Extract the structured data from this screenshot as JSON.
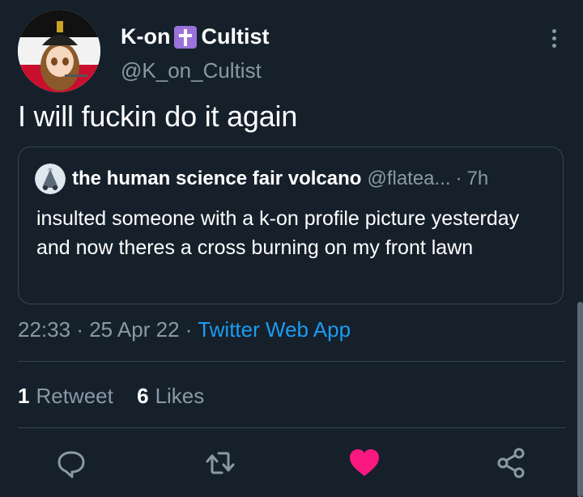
{
  "user": {
    "display_name_part1": "K-on",
    "display_name_part2": "Cultist",
    "handle": "@K_on_Cultist"
  },
  "tweet": {
    "text": "I will fuckin do it again"
  },
  "quote": {
    "name": "the human science fair volcano",
    "handle": "@flatea...",
    "dot": "·",
    "time": "7h",
    "text": "insulted someone with a k-on profile picture yesterday and now theres a cross burning on my front lawn"
  },
  "meta": {
    "time": "22:33",
    "sep1": "·",
    "date": "25 Apr 22",
    "sep2": "·",
    "source": "Twitter Web App"
  },
  "stats": {
    "retweets_count": "1",
    "retweets_label": "Retweet",
    "likes_count": "6",
    "likes_label": "Likes"
  },
  "actions": [
    "reply-icon",
    "retweet-icon",
    "like-icon",
    "share-icon"
  ],
  "colors": {
    "background": "#15202b",
    "link": "#1d9bf0",
    "muted": "#8b98a5",
    "like": "#f91880"
  }
}
